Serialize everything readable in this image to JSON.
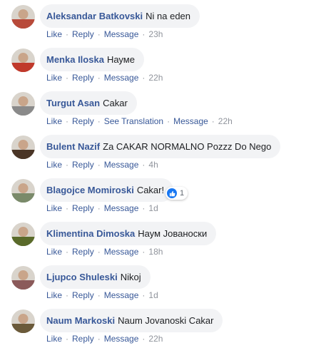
{
  "comments": [
    {
      "author": "Aleksandar Batkovski",
      "text": "Ni na eden",
      "actions": [
        "Like",
        "Reply",
        "Message"
      ],
      "time": "23h",
      "avatar_color": "#b84a3a"
    },
    {
      "author": "Menka Iloska",
      "text": "Науме",
      "actions": [
        "Like",
        "Reply",
        "Message"
      ],
      "time": "22h",
      "avatar_color": "#c0392b"
    },
    {
      "author": "Turgut Asan",
      "text": "Cakar",
      "actions": [
        "Like",
        "Reply",
        "See Translation",
        "Message"
      ],
      "time": "22h",
      "avatar_color": "#8a8a8a"
    },
    {
      "author": "Bulent Nazif",
      "text": "Za CAKAR NORMALNO Pozzz Do Nego",
      "actions": [
        "Like",
        "Reply",
        "Message"
      ],
      "time": "4h",
      "avatar_color": "#4a3526"
    },
    {
      "author": "Blagojce Momiroski",
      "text": "Cakar!",
      "actions": [
        "Like",
        "Reply",
        "Message"
      ],
      "time": "1d",
      "avatar_color": "#7a8a6a"
    },
    {
      "author": "Klimentina Dimoska",
      "text": "Наум Јованоски",
      "actions": [
        "Like",
        "Reply",
        "Message"
      ],
      "time": "18h",
      "avatar_color": "#5a6a2a"
    },
    {
      "author": "Ljupco Shuleski",
      "text": "Nikoj",
      "actions": [
        "Like",
        "Reply",
        "Message"
      ],
      "time": "1d",
      "avatar_color": "#8b5a5a"
    },
    {
      "author": "Naum Markoski",
      "text": "Naum Jovanoski Cakar",
      "actions": [
        "Like",
        "Reply",
        "Message"
      ],
      "time": "22h",
      "avatar_color": "#6b5a3a"
    }
  ],
  "reaction": {
    "icon": "like-icon",
    "count": "1",
    "color": "#1877f2"
  }
}
